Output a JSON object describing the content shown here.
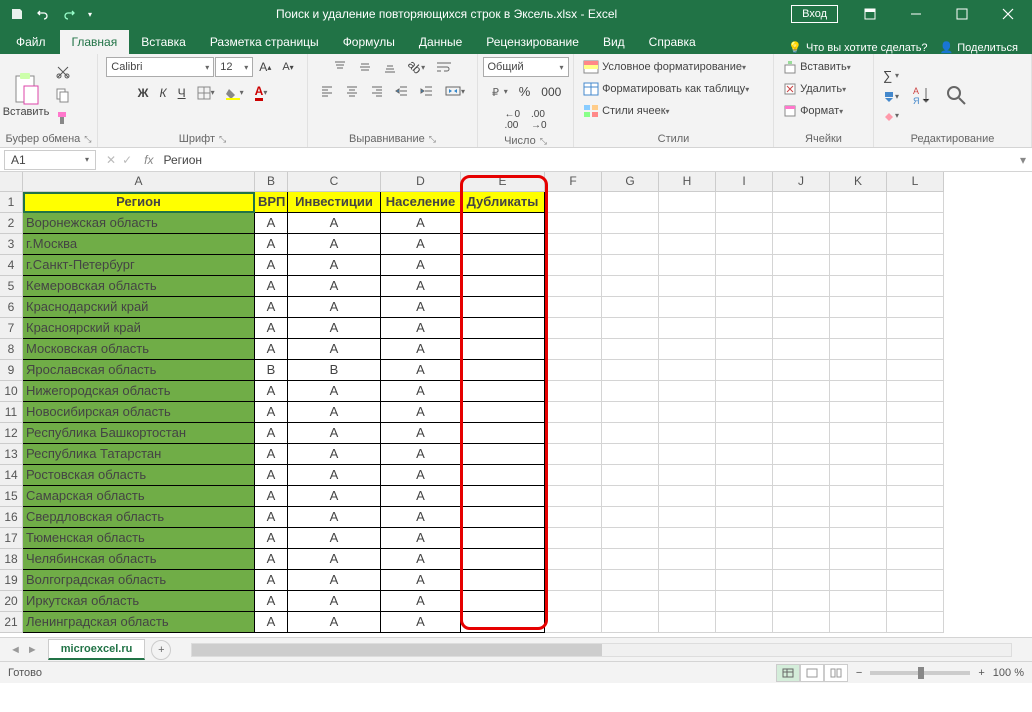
{
  "titlebar": {
    "title": "Поиск и удаление повторяющихся строк в Эксель.xlsx - Excel",
    "login": "Вход"
  },
  "tabs": {
    "file": "Файл",
    "items": [
      "Главная",
      "Вставка",
      "Разметка страницы",
      "Формулы",
      "Данные",
      "Рецензирование",
      "Вид",
      "Справка"
    ],
    "active": 0,
    "tell_me": "Что вы хотите сделать?",
    "share": "Поделиться"
  },
  "ribbon": {
    "clipboard": {
      "paste": "Вставить",
      "label": "Буфер обмена"
    },
    "font": {
      "name": "Calibri",
      "size": "12",
      "b": "Ж",
      "i": "К",
      "u": "Ч",
      "label": "Шрифт"
    },
    "align": {
      "label": "Выравнивание"
    },
    "number": {
      "format": "Общий",
      "label": "Число"
    },
    "styles": {
      "cond": "Условное форматирование",
      "table": "Форматировать как таблицу",
      "cell": "Стили ячеек",
      "label": "Стили"
    },
    "cells": {
      "insert": "Вставить",
      "delete": "Удалить",
      "format": "Формат",
      "label": "Ячейки"
    },
    "editing": {
      "label": "Редактирование"
    }
  },
  "fbar": {
    "name": "A1",
    "formula": "Регион"
  },
  "grid": {
    "col_widths": {
      "A": 232,
      "B": 33,
      "C": 93,
      "D": 80,
      "E": 84,
      "rest": 57
    },
    "columns": [
      "A",
      "B",
      "C",
      "D",
      "E",
      "F",
      "G",
      "H",
      "I",
      "J",
      "K",
      "L"
    ],
    "headers": [
      "Регион",
      "ВРП",
      "Инвестиции",
      "Население",
      "Дубликаты"
    ],
    "rows": [
      {
        "n": 2,
        "r": "Воронежская область",
        "v": [
          "A",
          "A",
          "A"
        ]
      },
      {
        "n": 3,
        "r": "г.Москва",
        "v": [
          "A",
          "A",
          "A"
        ]
      },
      {
        "n": 4,
        "r": "г.Санкт-Петербург",
        "v": [
          "A",
          "A",
          "A"
        ]
      },
      {
        "n": 5,
        "r": "Кемеровская область",
        "v": [
          "A",
          "A",
          "A"
        ]
      },
      {
        "n": 6,
        "r": "Краснодарский край",
        "v": [
          "A",
          "A",
          "A"
        ]
      },
      {
        "n": 7,
        "r": "Красноярский край",
        "v": [
          "A",
          "A",
          "A"
        ]
      },
      {
        "n": 8,
        "r": "Московская область",
        "v": [
          "A",
          "A",
          "A"
        ]
      },
      {
        "n": 9,
        "r": "Ярославская область",
        "v": [
          "B",
          "B",
          "A"
        ]
      },
      {
        "n": 10,
        "r": "Нижегородская область",
        "v": [
          "A",
          "A",
          "A"
        ]
      },
      {
        "n": 11,
        "r": "Новосибирская область",
        "v": [
          "A",
          "A",
          "A"
        ]
      },
      {
        "n": 12,
        "r": "Республика Башкортостан",
        "v": [
          "A",
          "A",
          "A"
        ]
      },
      {
        "n": 13,
        "r": "Республика Татарстан",
        "v": [
          "A",
          "A",
          "A"
        ]
      },
      {
        "n": 14,
        "r": "Ростовская область",
        "v": [
          "A",
          "A",
          "A"
        ]
      },
      {
        "n": 15,
        "r": "Самарская область",
        "v": [
          "A",
          "A",
          "A"
        ]
      },
      {
        "n": 16,
        "r": "Свердловская область",
        "v": [
          "A",
          "A",
          "A"
        ]
      },
      {
        "n": 17,
        "r": "Тюменская область",
        "v": [
          "A",
          "A",
          "A"
        ]
      },
      {
        "n": 18,
        "r": "Челябинская область",
        "v": [
          "A",
          "A",
          "A"
        ]
      },
      {
        "n": 19,
        "r": "Волгоградская область",
        "v": [
          "A",
          "A",
          "A"
        ]
      },
      {
        "n": 20,
        "r": "Иркутская область",
        "v": [
          "A",
          "A",
          "A"
        ]
      },
      {
        "n": 21,
        "r": "Ленинградская область",
        "v": [
          "A",
          "A",
          "A"
        ]
      }
    ]
  },
  "sheets": {
    "active": "microexcel.ru"
  },
  "status": {
    "ready": "Готово",
    "zoom": "100 %"
  }
}
